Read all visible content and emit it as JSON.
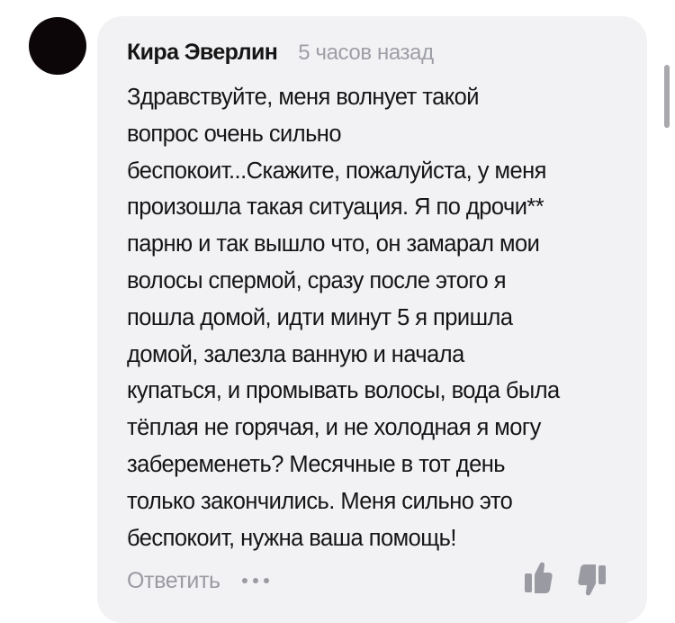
{
  "comment": {
    "author": "Кира Эверлин",
    "time": "5 часов назад",
    "text": "Здравствуйте, меня волнует такой\nвопрос очень сильно\nбеспокоит...Скажите, пожалуйста, у меня\nпроизошла такая ситуация. Я по дрочи**\nпарню и так вышло что, он замарал мои\nволосы спермой, сразу после этого я\nпошла домой, идти минут 5 я пришла\nдомой, залезла ванную и начала\nкупаться, и промывать волосы, вода была\nтёплая не горячая, и не холодная я могу\nзабеременеть? Месячные в тот день\nтолько закончились. Меня сильно это\nбеспокоит, нужна ваша помощь!"
  },
  "actions": {
    "reply_label": "Ответить",
    "more_icon": "more-dots-icon",
    "like_icon": "thumbs-up-icon",
    "dislike_icon": "thumbs-down-icon"
  },
  "colors": {
    "bubble": "#f2f2f5",
    "text": "#151515",
    "muted": "#9a9aa2",
    "avatar": "#0c0608"
  }
}
